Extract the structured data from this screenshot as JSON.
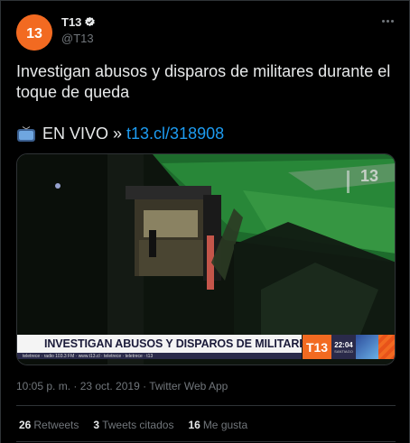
{
  "author": {
    "name": "T13",
    "handle": "@T13",
    "avatar_text": "13",
    "verified": true
  },
  "tweet": {
    "text": "Investigan abusos y disparos de militares durante el toque de queda",
    "live_label": "EN VIVO »",
    "live_link": "t13.cl/318908",
    "live_icon": "television-icon"
  },
  "media": {
    "watermark": "13",
    "ticker_headline": "INVESTIGAN ABUSOS Y DISPAROS DE MILITARES",
    "ticker_sub": "teletrece · radio 103.3 FM · www.t13.cl · teletrece · teletrece · t13",
    "ticker_logo": "T13",
    "ticker_time": "22:04",
    "ticker_city": "SANTIAGO"
  },
  "meta": {
    "timestamp": "10:05 p. m. · 23 oct. 2019 · Twitter Web App"
  },
  "stats": {
    "retweets_count": "26",
    "retweets_label": "Retweets",
    "quotes_count": "3",
    "quotes_label": "Tweets citados",
    "likes_count": "16",
    "likes_label": "Me gusta"
  },
  "colors": {
    "accent": "#1d9bf0",
    "brand": "#f26a21",
    "background": "#000000",
    "muted": "#71767b"
  }
}
